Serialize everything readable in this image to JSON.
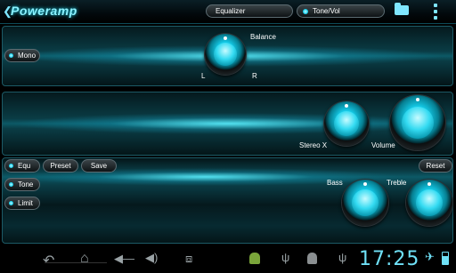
{
  "topbar": {
    "title": "Poweramp",
    "tabs": [
      {
        "label": "Equalizer"
      },
      {
        "label": "Tone/Vol"
      }
    ]
  },
  "balance_panel": {
    "mono_label": "Mono",
    "balance_label": "Balance",
    "left_label": "L",
    "right_label": "R"
  },
  "volume_panel": {
    "stereo_label": "Stereo X",
    "volume_label": "Volume"
  },
  "tone_panel": {
    "equ_label": "Equ",
    "preset_label": "Preset",
    "save_label": "Save",
    "reset_label": "Reset",
    "tone_label": "Tone",
    "limit_label": "Limit",
    "bass_label": "Bass",
    "treble_label": "Treble"
  },
  "statusbar": {
    "time": "17:25"
  },
  "icons": [
    "back-icon",
    "folder-icon",
    "menu-icon",
    "home-icon",
    "recent-apps-icon",
    "volume-down-icon",
    "volume-up-icon",
    "android-icon",
    "usb-icon",
    "airplane-icon",
    "battery-icon"
  ],
  "colors": {
    "accent": "#1bd3f0",
    "background": "#000000"
  }
}
